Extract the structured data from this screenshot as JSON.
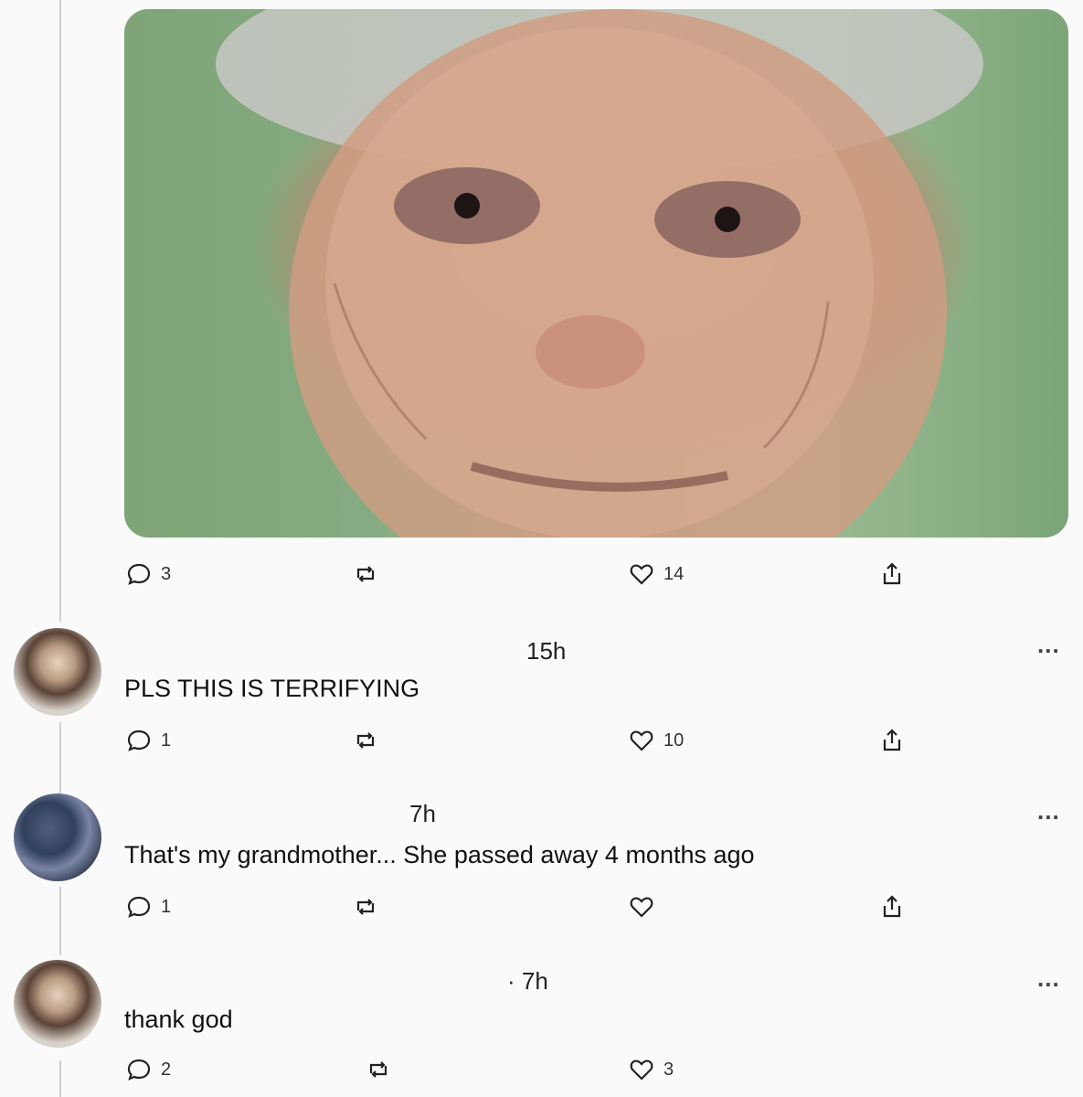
{
  "post": {
    "actions": {
      "replies": "3",
      "likes": "14"
    }
  },
  "comments": [
    {
      "time": "15h",
      "text": "PLS THIS IS TERRIFYING",
      "replies": "1",
      "likes": "10"
    },
    {
      "time": "7h",
      "text": "That's my grandmother... She passed away 4 months ago",
      "replies": "1",
      "likes": ""
    },
    {
      "time": "· 7h",
      "text": "thank god",
      "replies": "2",
      "likes": "3"
    }
  ],
  "icons": {
    "reply": "speech-bubble-icon",
    "repost": "repost-arrows-icon",
    "like": "heart-icon",
    "share": "share-upload-icon",
    "more": "more-dots-icon"
  },
  "more_label": "...",
  "colors": {
    "background": "#fafafa",
    "text": "#111111",
    "thread_line": "#cfcfcf"
  }
}
